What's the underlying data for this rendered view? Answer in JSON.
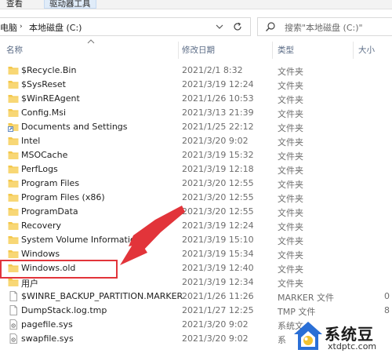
{
  "ribbon": {
    "view_tab": "查看",
    "drive_tools_tab": "驱动器工具"
  },
  "address": {
    "this_pc": "电脑",
    "separator": "›",
    "current": "本地磁盘 (C:)"
  },
  "search": {
    "placeholder": "搜索\"本地磁盘 (C:)\""
  },
  "columns": {
    "name": "名称",
    "date": "修改日期",
    "type": "类型",
    "size": "大小"
  },
  "files": [
    {
      "name": "$Recycle.Bin",
      "date": "2021/2/1 8:32",
      "type": "文件夹",
      "size": "",
      "icon": "folder-icon"
    },
    {
      "name": "$SysReset",
      "date": "2021/3/19 12:24",
      "type": "文件夹",
      "size": "",
      "icon": "folder-icon"
    },
    {
      "name": "$WinREAgent",
      "date": "2021/1/26 10:53",
      "type": "文件夹",
      "size": "",
      "icon": "folder-icon"
    },
    {
      "name": "Config.Msi",
      "date": "2021/3/13 21:39",
      "type": "文件夹",
      "size": "",
      "icon": "folder-icon"
    },
    {
      "name": "Documents and Settings",
      "date": "2021/1/25 22:12",
      "type": "文件夹",
      "size": "",
      "icon": "folder-shortcut-icon"
    },
    {
      "name": "Intel",
      "date": "2021/3/20 9:02",
      "type": "文件夹",
      "size": "",
      "icon": "folder-icon"
    },
    {
      "name": "MSOCache",
      "date": "2021/3/19 15:32",
      "type": "文件夹",
      "size": "",
      "icon": "folder-icon"
    },
    {
      "name": "PerfLogs",
      "date": "2021/3/19 12:18",
      "type": "文件夹",
      "size": "",
      "icon": "folder-icon"
    },
    {
      "name": "Program Files",
      "date": "2021/3/20 12:55",
      "type": "文件夹",
      "size": "",
      "icon": "folder-icon"
    },
    {
      "name": "Program Files (x86)",
      "date": "2021/3/20 12:55",
      "type": "文件夹",
      "size": "",
      "icon": "folder-icon"
    },
    {
      "name": "ProgramData",
      "date": "2021/3/20 12:55",
      "type": "文件夹",
      "size": "",
      "icon": "folder-icon"
    },
    {
      "name": "Recovery",
      "date": "2021/3/19 12:24",
      "type": "文件夹",
      "size": "",
      "icon": "folder-icon"
    },
    {
      "name": "System Volume Information",
      "date": "2021/3/19 15:10",
      "type": "文件夹",
      "size": "",
      "icon": "folder-icon"
    },
    {
      "name": "Windows",
      "date": "2021/3/19 15:34",
      "type": "文件夹",
      "size": "",
      "icon": "folder-icon"
    },
    {
      "name": "Windows.old",
      "date": "2021/3/19 12:40",
      "type": "文件夹",
      "size": "",
      "icon": "folder-icon"
    },
    {
      "name": "用户",
      "date": "2021/3/19 12:34",
      "type": "文件夹",
      "size": "",
      "icon": "folder-icon"
    },
    {
      "name": "$WINRE_BACKUP_PARTITION.MARKER",
      "date": "2021/1/26 11:26",
      "type": "MARKER 文件",
      "size": "0",
      "icon": "file-icon"
    },
    {
      "name": "DumpStack.log.tmp",
      "date": "2021/1/27 12:25",
      "type": "TMP 文件",
      "size": "8",
      "icon": "file-icon"
    },
    {
      "name": "pagefile.sys",
      "date": "2021/3/20 9:02",
      "type": "系统文",
      "size": "",
      "icon": "system-file-icon"
    },
    {
      "name": "swapfile.sys",
      "date": "2021/3/20 9:02",
      "type": "系",
      "size": "",
      "icon": "system-file-icon"
    }
  ],
  "watermark": {
    "title": "系统豆",
    "url": "xtdptc.com"
  },
  "colors": {
    "folder": "#f3c74a",
    "highlight_box": "#e2343a",
    "arrow": "#e2343a",
    "header_text": "#5a6b85"
  }
}
